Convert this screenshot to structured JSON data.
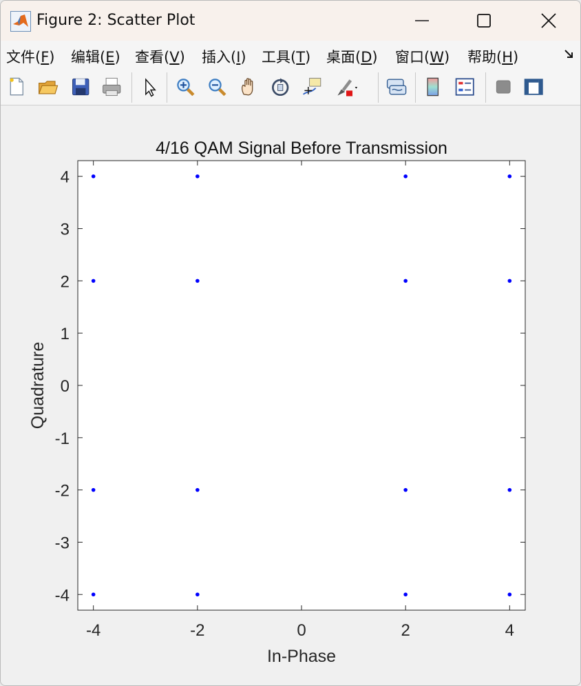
{
  "window": {
    "title": "Figure 2: Scatter Plot",
    "controls": {
      "minimize": "minimize",
      "maximize": "maximize",
      "close": "close"
    }
  },
  "menu": [
    {
      "label": "文件(",
      "key": "F",
      "tail": ")"
    },
    {
      "label": "编辑(",
      "key": "E",
      "tail": ")"
    },
    {
      "label": "查看(",
      "key": "V",
      "tail": ")"
    },
    {
      "label": "插入(",
      "key": "I",
      "tail": ")"
    },
    {
      "label": "工具(",
      "key": "T",
      "tail": ")"
    },
    {
      "label": "桌面(",
      "key": "D",
      "tail": ")"
    },
    {
      "label": "窗口(",
      "key": "W",
      "tail": ")"
    },
    {
      "label": "帮助(",
      "key": "H",
      "tail": ")"
    }
  ],
  "toolbar": [
    "new-figure-icon",
    "open-file-icon",
    "save-icon",
    "print-icon",
    "pointer-icon",
    "zoom-in-icon",
    "zoom-out-icon",
    "pan-icon",
    "rotate-3d-icon",
    "data-cursor-icon",
    "brush-icon",
    "link-plot-icon",
    "colorbar-icon",
    "legend-icon",
    "hide-plot-tools-icon",
    "show-plot-tools-icon"
  ],
  "chart_data": {
    "type": "scatter",
    "title": "4/16 QAM Signal Before Transmission",
    "xlabel": "In-Phase",
    "ylabel": "Quadrature",
    "xlim": [
      -4.3,
      4.3
    ],
    "ylim": [
      -4.3,
      4.3
    ],
    "xticks": [
      -4,
      -2,
      0,
      2,
      4
    ],
    "yticks": [
      -4,
      -3,
      -2,
      -1,
      0,
      1,
      2,
      3,
      4
    ],
    "marker_color": "#0000ff",
    "grid": false,
    "points": [
      [
        -4,
        4
      ],
      [
        -2,
        4
      ],
      [
        2,
        4
      ],
      [
        4,
        4
      ],
      [
        -4,
        2
      ],
      [
        -2,
        2
      ],
      [
        2,
        2
      ],
      [
        4,
        2
      ],
      [
        -4,
        -2
      ],
      [
        -2,
        -2
      ],
      [
        2,
        -2
      ],
      [
        4,
        -2
      ],
      [
        -4,
        -4
      ],
      [
        -2,
        -4
      ],
      [
        2,
        -4
      ],
      [
        4,
        -4
      ]
    ]
  }
}
